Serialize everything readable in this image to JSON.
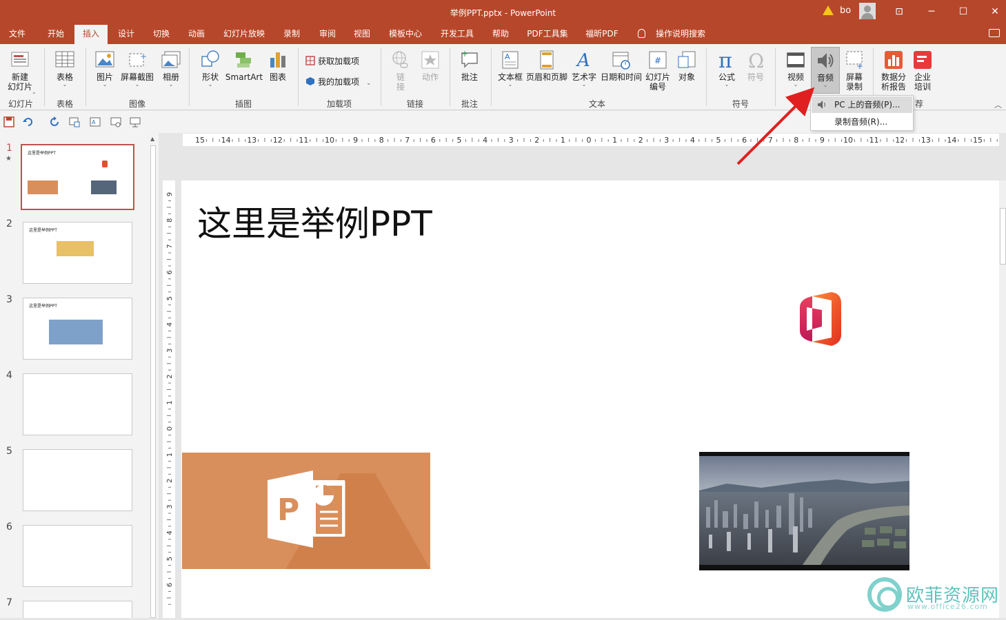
{
  "window": {
    "title": "举例PPT.pptx  -  PowerPoint",
    "user": "bo",
    "controls": {
      "ribbon_display": "⊡",
      "minimize": "─",
      "maximize": "☐",
      "close": "✕"
    }
  },
  "menu": {
    "tabs": [
      "文件",
      "开始",
      "插入",
      "设计",
      "切换",
      "动画",
      "幻灯片放映",
      "录制",
      "审阅",
      "视图",
      "模板中心",
      "开发工具",
      "帮助",
      "PDF工具集",
      "福昕PDF"
    ],
    "active": "插入",
    "search": "操作说明搜索"
  },
  "ribbon": {
    "groups": {
      "slides": "幻灯片",
      "tables": "表格",
      "images": "图像",
      "illustrations": "插图",
      "addins": "加载项",
      "links": "链接",
      "comments": "批注",
      "text": "文本",
      "symbols": "符号",
      "recommend": "荐"
    },
    "buttons": {
      "new_slide": "新建\n幻灯片",
      "table": "表格",
      "picture": "图片",
      "screenshot": "屏幕截图",
      "album": "相册",
      "shape": "形状",
      "smartart": "SmartArt",
      "chart": "图表",
      "get_addins": "获取加载项",
      "my_addins": "我的加载项",
      "link": "链\n接",
      "action": "动作",
      "comment": "批注",
      "textbox": "文本框",
      "header_footer": "页眉和页脚",
      "wordart": "艺术字",
      "datetime": "日期和时间",
      "slide_number": "幻灯片\n编号",
      "object": "对象",
      "equation": "公式",
      "symbol": "符号",
      "video": "视频",
      "audio": "音频",
      "screen_record": "屏幕\n录制",
      "data_report": "数据分\n析报告",
      "enterprise_training": "企业\n培训"
    }
  },
  "dropdown": {
    "items": [
      "PC 上的音频(P)...",
      "录制音频(R)..."
    ],
    "highlighted": 0
  },
  "thumbnails": [
    {
      "num": "1",
      "title": "这里是举例PPT",
      "selected": true
    },
    {
      "num": "2",
      "title": "这里是举例PPT"
    },
    {
      "num": "3",
      "title": "这里是举例PPT"
    },
    {
      "num": "4",
      "title": ""
    },
    {
      "num": "5",
      "title": ""
    },
    {
      "num": "6",
      "title": ""
    },
    {
      "num": "7",
      "title": ""
    }
  ],
  "ruler": {
    "horizontal": [
      "15",
      "14",
      "13",
      "12",
      "11",
      "10",
      "9",
      "8",
      "7",
      "6",
      "5",
      "4",
      "3",
      "2",
      "1",
      "0",
      "1",
      "2",
      "3",
      "4",
      "5",
      "6",
      "7",
      "8",
      "9",
      "10",
      "11",
      "12",
      "13",
      "14",
      "15"
    ],
    "vertical": [
      "9",
      "8",
      "7",
      "6",
      "5",
      "4",
      "3",
      "2",
      "1",
      "0",
      "1",
      "2",
      "3",
      "4",
      "5",
      "6"
    ]
  },
  "slide": {
    "title": "这里是举例PPT"
  },
  "watermark": {
    "name": "欧菲资源网",
    "url": "www.office26.com"
  },
  "colors": {
    "accent": "#b7472a",
    "ppt_orange": "#d98f5c",
    "selected_thumb": "#c0504d",
    "arrow": "#e02020"
  }
}
